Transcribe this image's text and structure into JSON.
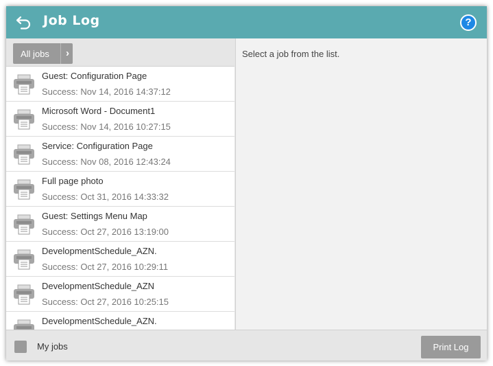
{
  "header": {
    "title": "Job Log",
    "help_symbol": "?",
    "bar_color": "#5aaab0"
  },
  "filter": {
    "all_jobs_label": "All jobs",
    "chevron": "›"
  },
  "jobs": [
    {
      "name": "Guest: Configuration Page",
      "status": "Success: Nov 14, 2016 14:37:12",
      "icon": "printer-icon"
    },
    {
      "name": "Microsoft Word - Document1",
      "status": "Success: Nov 14, 2016 10:27:15",
      "icon": "printer-icon"
    },
    {
      "name": "Service: Configuration Page",
      "status": "Success: Nov 08, 2016 12:43:24",
      "icon": "printer-icon"
    },
    {
      "name": "Full page photo",
      "status": "Success: Oct 31, 2016 14:33:32",
      "icon": "printer-icon"
    },
    {
      "name": "Guest: Settings Menu Map",
      "status": "Success: Oct 27, 2016 13:19:00",
      "icon": "printer-icon"
    },
    {
      "name": "DevelopmentSchedule_AZN.",
      "status": "Success: Oct 27, 2016 10:29:11",
      "icon": "printer-icon"
    },
    {
      "name": "DevelopmentSchedule_AZN",
      "status": "Success: Oct 27, 2016 10:25:15",
      "icon": "printer-icon"
    },
    {
      "name": "DevelopmentSchedule_AZN.",
      "status": "",
      "icon": "printer-icon"
    }
  ],
  "detail": {
    "hint": "Select a job from the list."
  },
  "footer": {
    "my_jobs_label": "My jobs",
    "my_jobs_checked": false,
    "print_log_label": "Print Log"
  }
}
